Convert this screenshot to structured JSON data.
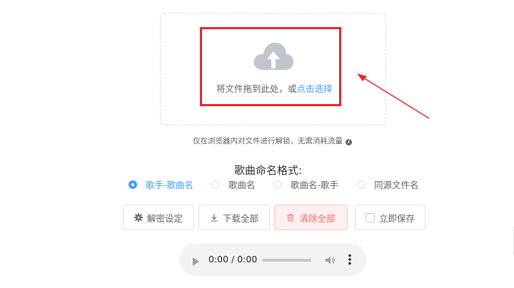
{
  "upload": {
    "drag_text": "将文件拖到此处，或",
    "click_text": "点击选择"
  },
  "hint": "仅在浏览器内对文件进行解锁，无需消耗流量",
  "naming": {
    "title": "歌曲命名格式:",
    "options": [
      "歌手-歌曲名",
      "歌曲名",
      "歌曲名-歌手",
      "同源文件名"
    ],
    "selected": "歌手-歌曲名"
  },
  "buttons": {
    "settings": "解密设定",
    "download_all": "下载全部",
    "clear_all": "清除全部",
    "save_now": "立即保存"
  },
  "player": {
    "time": "0:00 / 0:00"
  },
  "colors": {
    "accent": "#409eff",
    "danger": "#f56c6c",
    "annotation": "#e8262d"
  },
  "icons": {
    "upload": "cloud-upload-icon",
    "info": "info-icon",
    "settings": "gear-icon",
    "download": "download-icon",
    "delete": "trash-icon",
    "save": "checkbox-icon",
    "play": "play-icon",
    "volume": "volume-icon",
    "more": "more-vertical-icon"
  }
}
